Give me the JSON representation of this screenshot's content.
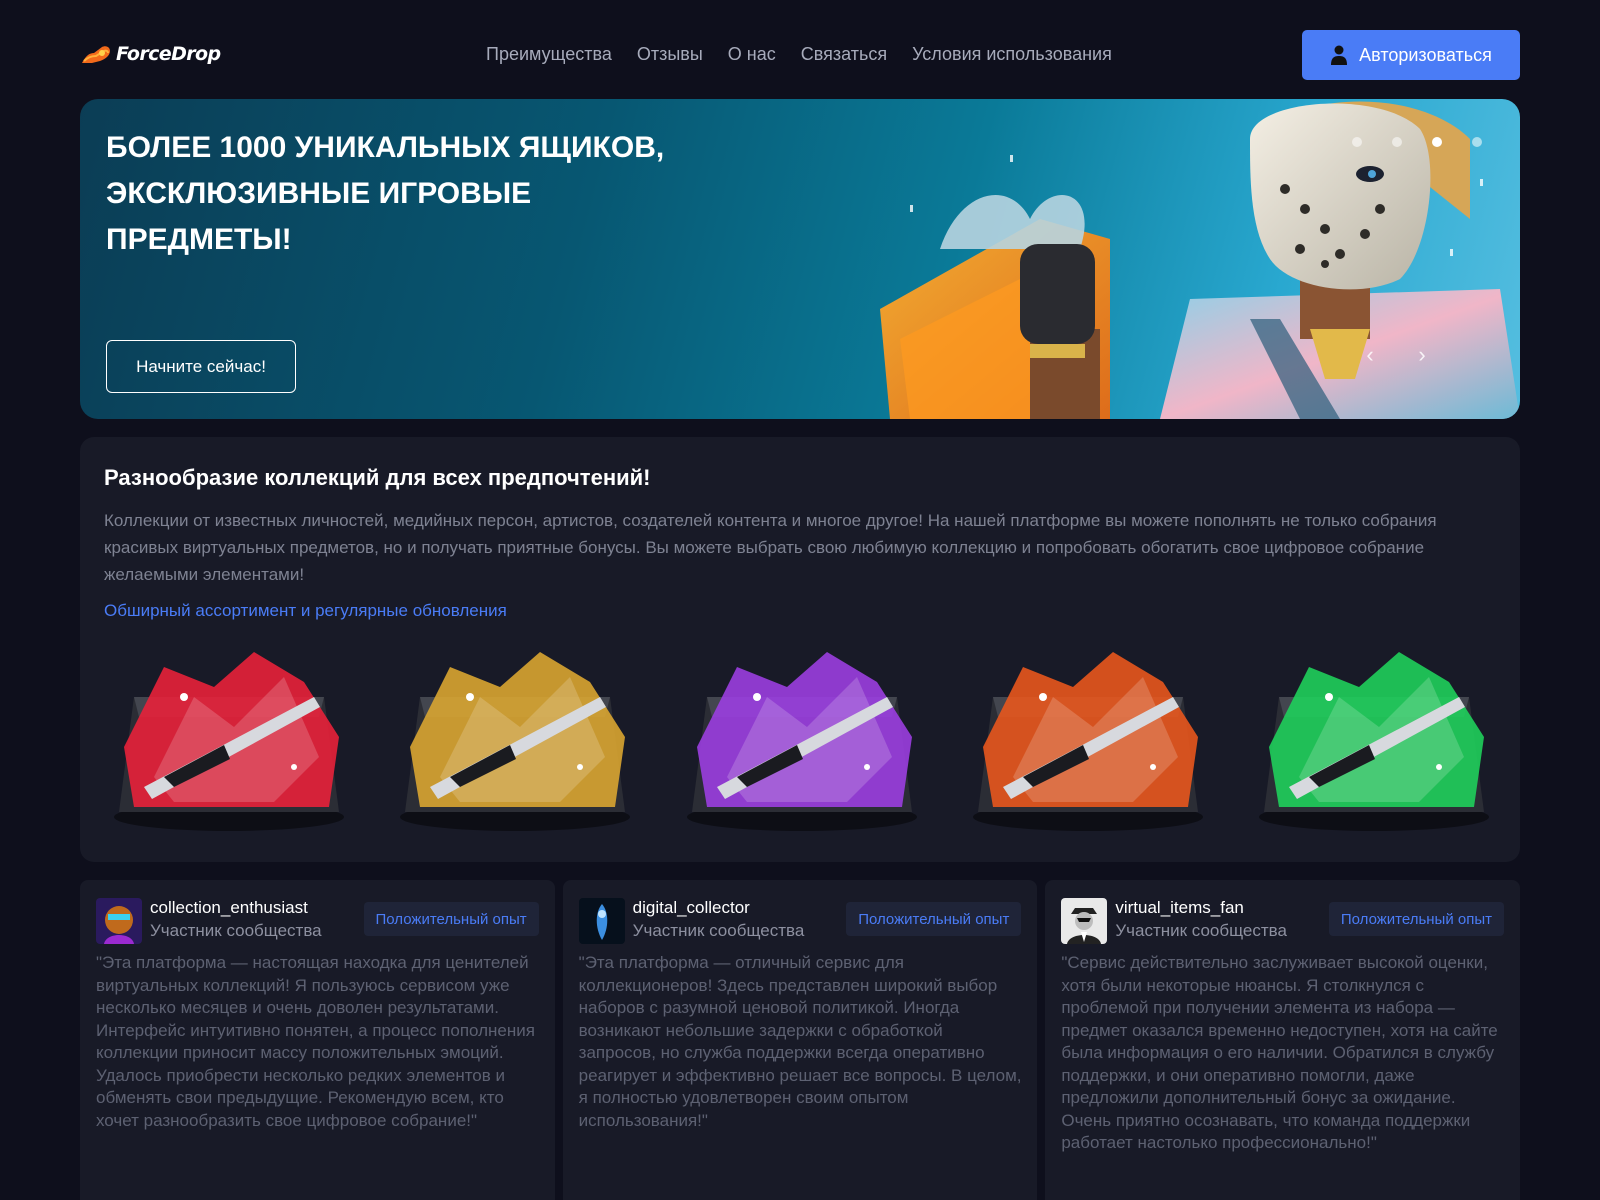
{
  "header": {
    "logo_text": "ForceDrop",
    "nav": [
      "Преимущества",
      "Отзывы",
      "О нас",
      "Связаться",
      "Условия использования"
    ],
    "login_label": "Авторизоваться"
  },
  "banner": {
    "title": "БОЛЕЕ 1000 УНИКАЛЬНЫХ ЯЩИКОВ, ЭКСКЛЮЗИВНЫЕ ИГРОВЫЕ ПРЕДМЕТЫ!",
    "cta_label": "Начните сейчас!",
    "slide_count": 4,
    "active_slide": 3,
    "prev_arrow": "‹",
    "next_arrow": "›"
  },
  "collections": {
    "title": "Разнообразие коллекций для всех предпочтений!",
    "description": "Коллекции от известных личностей, медийных персон, артистов, создателей контента и многое другое! На нашей платформе вы можете пополнять не только собрания красивых виртуальных предметов, но и получать приятные бонусы. Вы можете выбрать свою любимую коллекцию и попробовать обогатить свое цифровое собрание желаемыми элементами!",
    "link_label": "Обширный ассортимент и регулярные обновления",
    "cases": [
      {
        "name": "red-case",
        "color": "#e8213a"
      },
      {
        "name": "gold-case",
        "color": "#d9a531"
      },
      {
        "name": "purple-case",
        "color": "#9b3ee0"
      },
      {
        "name": "fire-case",
        "color": "#e8571d"
      },
      {
        "name": "green-case",
        "color": "#1fcf5b"
      }
    ]
  },
  "reviews": [
    {
      "name": "collection_enthusiast",
      "role": "Участник сообщества",
      "badge": "Положительный опыт",
      "text": "\"Эта платформа — настоящая находка для ценителей виртуальных коллекций! Я пользуюсь сервисом уже несколько месяцев и очень доволен результатами. Интерфейс интуитивно понятен, а процесс пополнения коллекции приносит массу положительных эмоций. Удалось приобрести несколько редких элементов и обменять свои предыдущие. Рекомендую всем, кто хочет разнообразить свое цифровое собрание!\""
    },
    {
      "name": "digital_collector",
      "role": "Участник сообщества",
      "badge": "Положительный опыт",
      "text": "\"Эта платформа — отличный сервис для коллекционеров! Здесь представлен широкий выбор наборов с разумной ценовой политикой. Иногда возникают небольшие задержки с обработкой запросов, но служба поддержки всегда оперативно реагирует и эффективно решает все вопросы. В целом, я полностью удовлетворен своим опытом использования!\""
    },
    {
      "name": "virtual_items_fan",
      "role": "Участник сообщества",
      "badge": "Положительный опыт",
      "text": "\"Сервис действительно заслуживает высокой оценки, хотя были некоторые нюансы. Я столкнулся с проблемой при получении элемента из набора — предмет оказался временно недоступен, хотя на сайте была информация о его наличии. Обратился в службу поддержки, и они оперативно помогли, даже предложили дополнительный бонус за ожидание. Очень приятно осознавать, что команда поддержки работает настолько профессионально!\""
    }
  ],
  "colors": {
    "background": "#0e0f1c",
    "card": "#181a27",
    "accent": "#4a7cf6",
    "muted_text": "#7e8292"
  }
}
